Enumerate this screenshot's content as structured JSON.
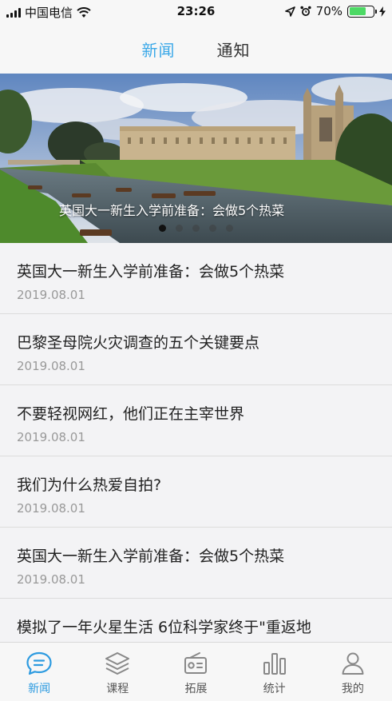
{
  "status_bar": {
    "carrier": "中国电信",
    "time": "23:26",
    "battery_percent": "70%",
    "battery_level": 0.7
  },
  "top_tabs": [
    {
      "label": "新闻",
      "active": true
    },
    {
      "label": "通知",
      "active": false
    }
  ],
  "banner": {
    "caption": "英国大一新生入学前准备：会做5个热菜",
    "slide_count": 5,
    "active_slide": 1
  },
  "news": [
    {
      "title": "英国大一新生入学前准备：会做5个热菜",
      "date": "2019.08.01"
    },
    {
      "title": "巴黎圣母院火灾调查的五个关键要点",
      "date": "2019.08.01"
    },
    {
      "title": "不要轻视网红，他们正在主宰世界",
      "date": "2019.08.01"
    },
    {
      "title": "我们为什么热爱自拍?",
      "date": "2019.08.01"
    },
    {
      "title": "英国大一新生入学前准备：会做5个热菜",
      "date": "2019.08.01"
    },
    {
      "title": "模拟了一年火星生活 6位科学家终于\"重返地",
      "date": ""
    }
  ],
  "bottom_nav": [
    {
      "label": "新闻",
      "icon": "chat-bubble-icon",
      "active": true
    },
    {
      "label": "课程",
      "icon": "layers-icon",
      "active": false
    },
    {
      "label": "拓展",
      "icon": "radio-icon",
      "active": false
    },
    {
      "label": "统计",
      "icon": "bar-chart-icon",
      "active": false
    },
    {
      "label": "我的",
      "icon": "user-icon",
      "active": false
    }
  ],
  "colors": {
    "accent": "#3aa8e8",
    "nav_active": "#2d9be0",
    "battery": "#4cd964"
  }
}
